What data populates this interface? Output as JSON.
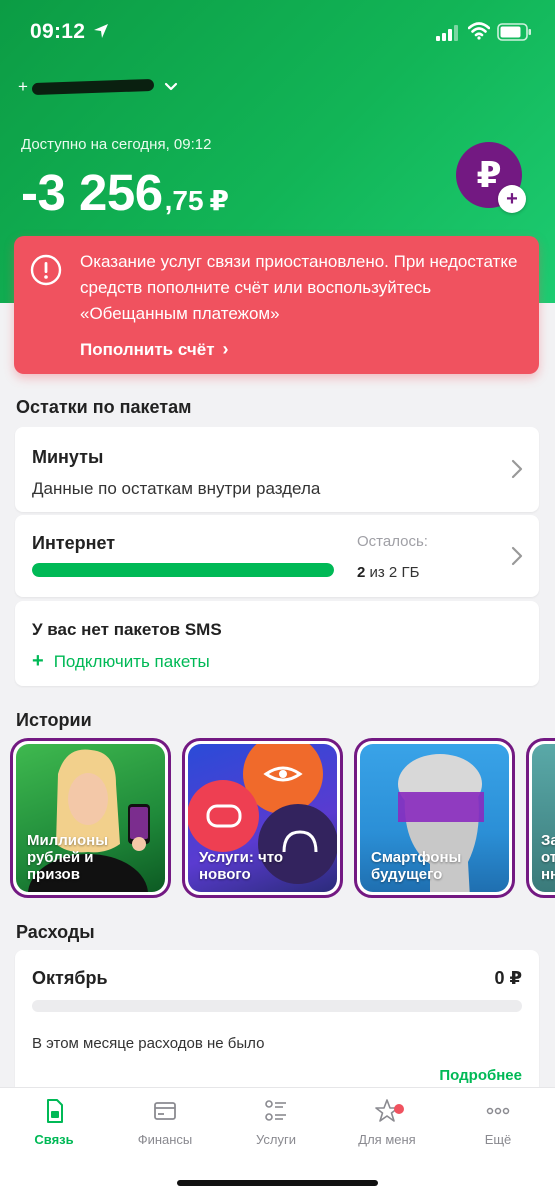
{
  "status_bar": {
    "time": "09:12"
  },
  "header": {
    "phone_prefix": "+",
    "available_label": "Доступно на сегодня, 09:12",
    "balance_main": "-3 256",
    "balance_kop": ",75",
    "currency": "₽",
    "topup_symbol": "₽",
    "topup_plus": "+"
  },
  "alert": {
    "text": "Оказание услуг связи приостановлено. При недостатке средств пополните счёт или воспользуйтесь «Обещанным платежом»",
    "link_label": "Пополнить счёт",
    "link_arrow": "›",
    "color": "#f0525f"
  },
  "packages": {
    "title": "Остатки по пакетам",
    "minutes": {
      "title": "Минуты",
      "subtitle": "Данные по остаткам внутри раздела"
    },
    "internet": {
      "title": "Интернет",
      "remain_label": "Осталось:",
      "remain_bold": "2",
      "remain_rest": " из 2 ГБ",
      "progress_fraction": 1.0
    },
    "sms": {
      "title": "У вас нет пакетов SMS",
      "connect_plus": "+",
      "connect_label": "Подключить пакеты"
    }
  },
  "stories": {
    "title": "Истории",
    "items": [
      {
        "label": "Миллионы рублей и призов"
      },
      {
        "label": "Услуги: что нового"
      },
      {
        "label": "Смартфоны будущего"
      },
      {
        "label": "За от нн"
      }
    ]
  },
  "expenses": {
    "title": "Расходы",
    "month": "Октябрь",
    "amount": "0 ₽",
    "empty_text": "В этом месяце расходов не было",
    "more_link": "Подробнее"
  },
  "tabbar": {
    "items": [
      {
        "label": "Связь",
        "icon": "sim-card-icon",
        "active": true
      },
      {
        "label": "Финансы",
        "icon": "wallet-icon"
      },
      {
        "label": "Услуги",
        "icon": "services-list-icon"
      },
      {
        "label": "Для меня",
        "icon": "star-icon",
        "badge": true
      },
      {
        "label": "Ещё",
        "icon": "more-dots-icon"
      }
    ]
  },
  "colors": {
    "brand_green": "#00b956",
    "brand_purple": "#731982",
    "alert_red": "#f0525f"
  }
}
